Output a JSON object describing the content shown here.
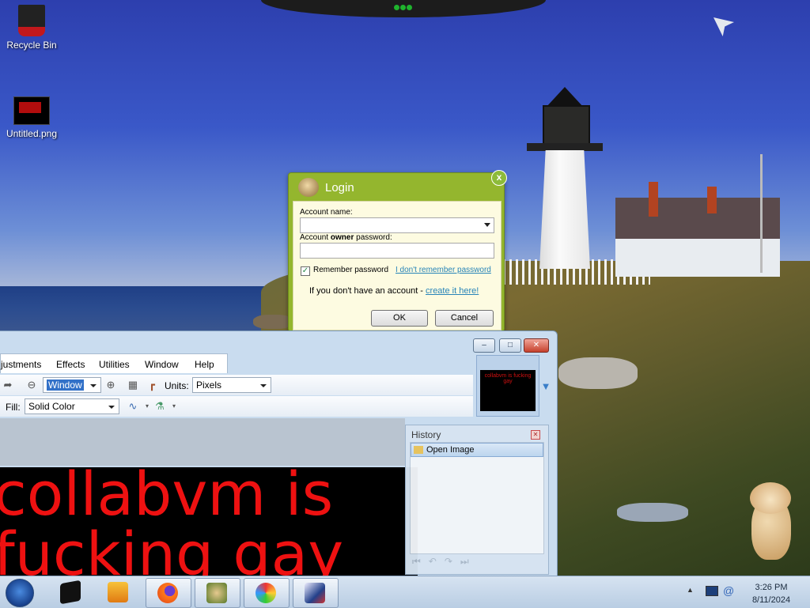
{
  "desktop": {
    "icons": [
      {
        "label": "Recycle Bin",
        "icon": "recycle-bin-icon"
      },
      {
        "label": "Untitled.png",
        "icon": "image-file-icon"
      }
    ]
  },
  "login": {
    "title": "Login",
    "close_glyph": "x",
    "account_name_label": "Account name:",
    "password_label_prefix": "Account ",
    "password_label_bold": "owner",
    "password_label_suffix": " password:",
    "account_name_value": "",
    "password_value": "",
    "remember_label": "Remember password",
    "remember_checked": true,
    "forgot_link": "I don't remember password",
    "no_account_text": "If you don't have an account - ",
    "create_link": "create it here!",
    "ok_label": "OK",
    "cancel_label": "Cancel"
  },
  "paintnet": {
    "menu": [
      "justments",
      "Effects",
      "Utilities",
      "Window",
      "Help"
    ],
    "zoom_value": "Window",
    "units_label": "Units:",
    "units_value": "Pixels",
    "fill_label": "Fill:",
    "fill_value": "Solid Color",
    "thumbnail_text": "collabvm is fucking gay",
    "canvas_text_line1": "collabvm is",
    "canvas_text_line2": "fucking gay",
    "history": {
      "title": "History",
      "items": [
        "Open Image"
      ]
    },
    "window_buttons": {
      "minimize": "–",
      "maximize": "□",
      "close": "✕"
    }
  },
  "taskbar": {
    "clock_time": "3:26 PM",
    "clock_date": "8/11/2024",
    "apps": [
      "media-player-icon",
      "firefox-icon",
      "pet-app-icon",
      "paint-icon",
      "paint-net-icon"
    ]
  },
  "colors": {
    "login_green": "#94b62e",
    "canvas_text": "#ee1111",
    "link": "#2784b8"
  }
}
